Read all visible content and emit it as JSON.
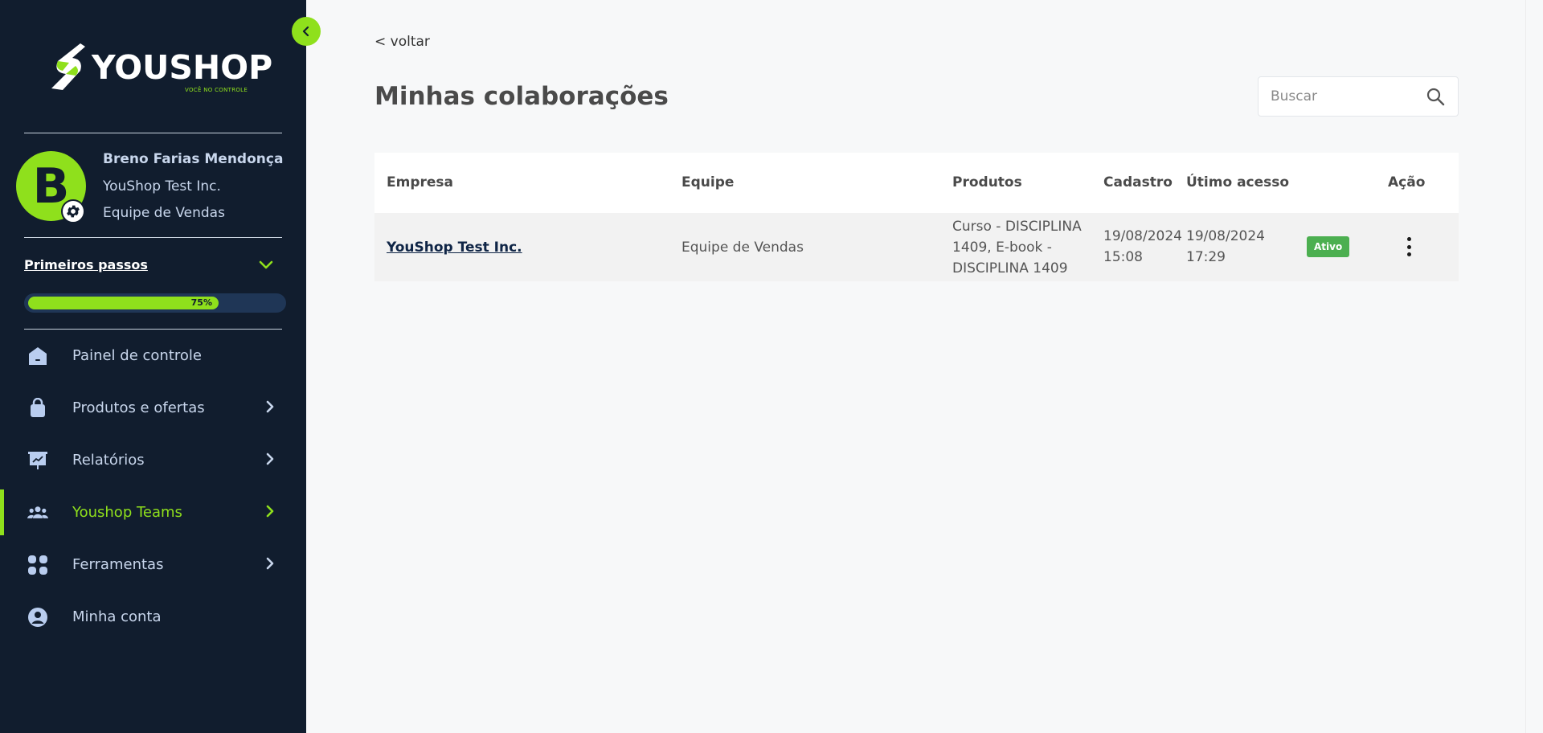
{
  "brand": {
    "name": "YOUSHOP",
    "tagline": "VOCÊ NO CONTROLE",
    "accent_color": "#8fe01c",
    "sidebar_color": "#111d2e"
  },
  "profile": {
    "initial": "B",
    "name": "Breno Farias Mendonça",
    "company": "YouShop Test Inc.",
    "team": "Equipe de Vendas"
  },
  "onboarding": {
    "label": "Primeiros passos",
    "progress_text": "75%",
    "progress": 0.75
  },
  "menu": {
    "items": [
      {
        "label": "Painel de controle",
        "icon": "home-icon",
        "has_submenu": false
      },
      {
        "label": "Produtos e ofertas",
        "icon": "bag-icon",
        "has_submenu": true
      },
      {
        "label": "Relatórios",
        "icon": "presentation-chart-icon",
        "has_submenu": true
      },
      {
        "label": "Youshop Teams",
        "icon": "team-icon",
        "has_submenu": true,
        "active": true
      },
      {
        "label": "Ferramentas",
        "icon": "apps-grid-icon",
        "has_submenu": true
      },
      {
        "label": "Minha conta",
        "icon": "user-circle-icon",
        "has_submenu": false
      }
    ]
  },
  "main": {
    "back_label": "< voltar",
    "title": "Minhas colaborações",
    "search_placeholder": "Buscar"
  },
  "table": {
    "headers": {
      "empresa": "Empresa",
      "equipe": "Equipe",
      "produtos": "Produtos",
      "cadastro": "Cadastro",
      "ultimo_acesso": "Útimo acesso",
      "acao": "Ação"
    },
    "rows": [
      {
        "empresa": "YouShop Test Inc.",
        "equipe": "Equipe de Vendas",
        "produtos_line1": "Curso - DISCIPLINA",
        "produtos_line2": "1409, E-book -",
        "produtos_line3": "DISCIPLINA 1409",
        "cadastro_date": "19/08/2024",
        "cadastro_time": "15:08",
        "acesso_date": "19/08/2024",
        "acesso_time": "17:29",
        "status": "Ativo",
        "status_color": "#4caf50"
      }
    ]
  }
}
